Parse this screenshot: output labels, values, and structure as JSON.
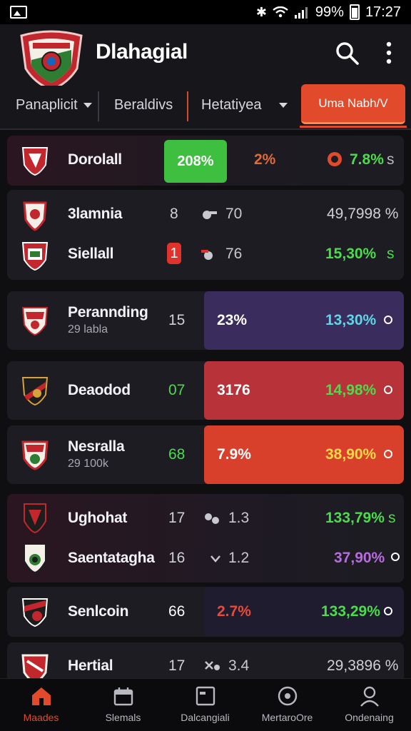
{
  "status_bar": {
    "battery": "99%",
    "time": "17:27"
  },
  "app": {
    "title": "Dlahagial"
  },
  "filters": {
    "f1": "Panaplicit",
    "f2": "Beraldivs",
    "f3": "Hetatiyea",
    "button": "Uma Nabh/V"
  },
  "rows": {
    "r1": {
      "name": "Dorolall",
      "badge": "208%",
      "pct": "2%",
      "pct_color": "#e06b3a",
      "value": "7.8%",
      "suffix": "s"
    },
    "r2": {
      "name": "3lamnia",
      "num": "8",
      "score": "70",
      "value": "49,7998 %"
    },
    "r3": {
      "name": "Siellall",
      "num": "1",
      "score": "76",
      "value": "15,30%",
      "suffix": "s"
    },
    "r4": {
      "name": "Perannding",
      "sub": "29 labla",
      "num": "15",
      "pct": "23%",
      "value": "13,30%"
    },
    "r5": {
      "name": "Deaodod",
      "num": "07",
      "pct": "3176",
      "value": "14,98%"
    },
    "r6": {
      "name": "Nesralla",
      "sub": "29 100k",
      "num": "68",
      "pct": "7.9%",
      "value": "38,90%"
    },
    "r7": {
      "name": "Ughohat",
      "num": "17",
      "score": "1.3",
      "value": "133,79%",
      "suffix": "s"
    },
    "r8": {
      "name": "Saentatagha",
      "num": "16",
      "score": "1.2",
      "value": "37,90%"
    },
    "r9": {
      "name": "Senlcoin",
      "num": "66",
      "pct": "2.7%",
      "value": "133,29%"
    },
    "r10": {
      "name": "Hertial",
      "num": "17",
      "score": "3.4",
      "value": "29,3896 %"
    }
  },
  "nav": [
    {
      "label": "Maades",
      "icon": "home-icon"
    },
    {
      "label": "Slemals",
      "icon": "calendar-icon"
    },
    {
      "label": "Dalcangiali",
      "icon": "screen-icon"
    },
    {
      "label": "MertaroOre",
      "icon": "ball-icon"
    },
    {
      "label": "Ondenaing",
      "icon": "user-icon"
    }
  ],
  "colors": {
    "accent": "#e14a2b",
    "green": "#4bdc4b",
    "cyan": "#5fd6e6",
    "yellow": "#ffd84a",
    "purple": "#b86be0"
  }
}
